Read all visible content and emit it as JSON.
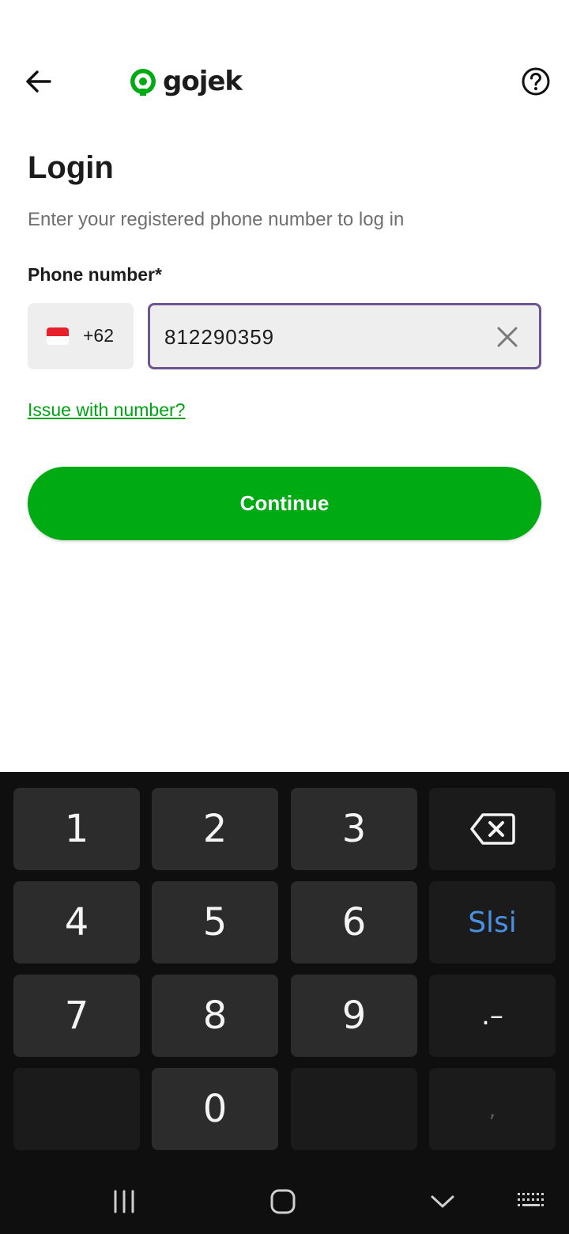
{
  "header": {
    "back_icon": "arrow-left-icon",
    "logo_text": "gojek",
    "logo_color": "#00aa13",
    "help_icon": "question-circle-icon"
  },
  "login": {
    "title": "Login",
    "subtitle": "Enter your registered phone number to log in",
    "field_label": "Phone number*",
    "country_code": "+62",
    "flag_icon": "indonesia-flag-icon",
    "phone_value": "812290359",
    "clear_icon": "close-icon",
    "issue_link": "Issue with number?",
    "continue_label": "Continue"
  },
  "colors": {
    "brand_green": "#00aa13",
    "input_focus_border": "#6e5494",
    "link_green": "#00a313"
  },
  "keyboard": {
    "keys": [
      "1",
      "2",
      "3",
      "4",
      "5",
      "6",
      "7",
      "8",
      "9",
      "0"
    ],
    "backspace_icon": "backspace-icon",
    "action_label": "Slsi",
    "symbol_label": ".–",
    "comma_label": ","
  },
  "navbar": {
    "recents_icon": "recents-icon",
    "home_icon": "home-icon",
    "hide_keyboard_icon": "chevron-down-icon",
    "keyboard_icon": "keyboard-icon"
  }
}
